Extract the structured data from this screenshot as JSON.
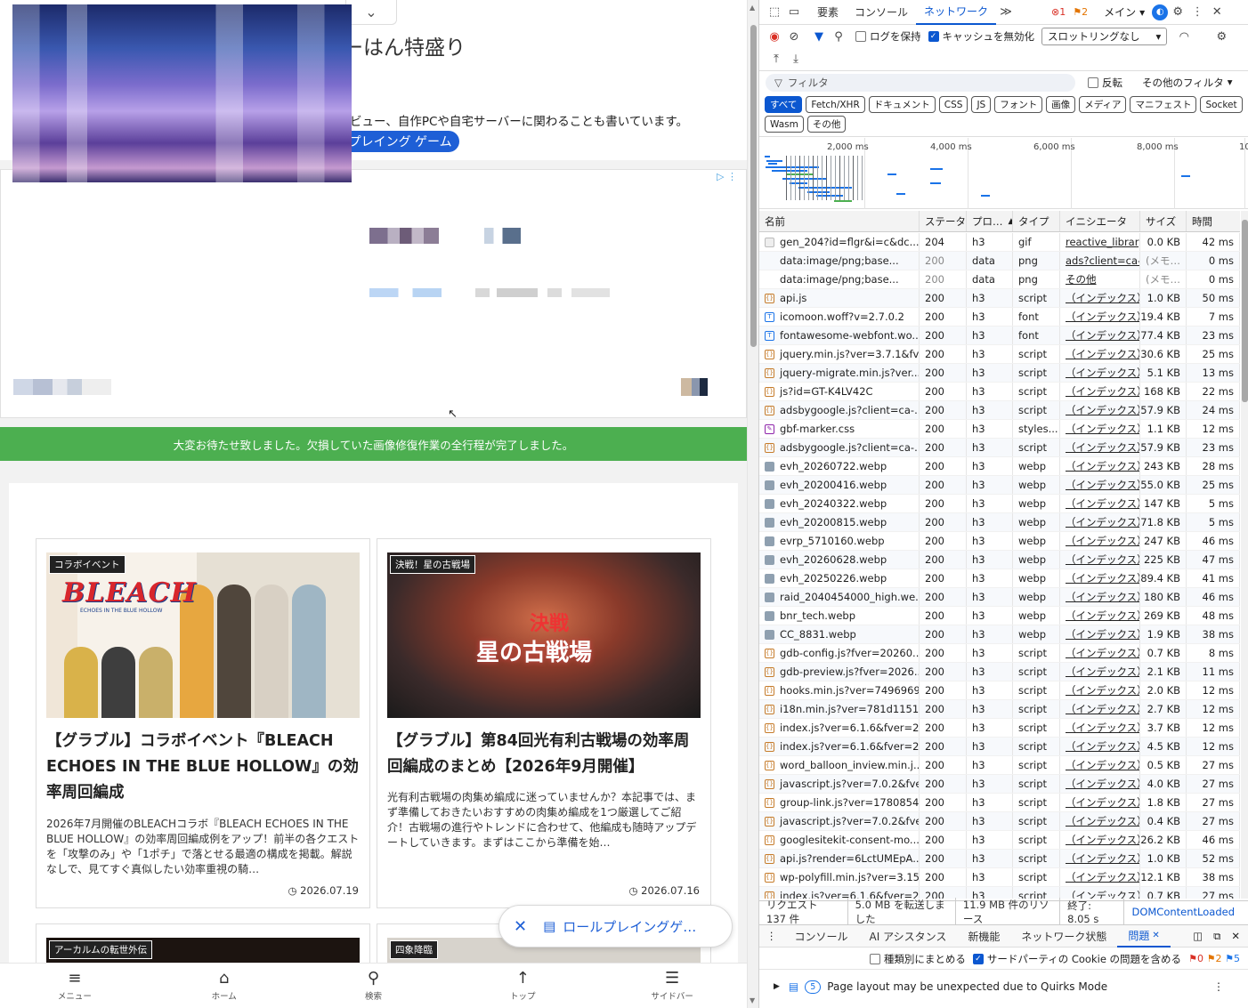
{
  "page": {
    "site_title": "半ちゃーはん特盛り",
    "site_description": "グラブルの攻略記事とその他PCパーツやデバイスのレビュー、自作PCや自宅サーバーに関わることも書いています。",
    "category_pill": "ロールプレイング ゲーム",
    "notice": "大変お待たせ致しました。欠損していた画像修復作業の全行程が完了しました。",
    "articles": [
      {
        "badge": "コラボイベント",
        "title": "【グラブル】コラボイベント『BLEACH ECHOES IN THE BLUE HOLLOW』の効率周回編成",
        "description": "2026年7月開催のBLEACHコラボ『BLEACH ECHOES IN THE BLUE HOLLOW』の効率周回編成例をアップ！前半の各クエストを「攻撃のみ」や「1ポチ」で落とせる最適の構成を掲載。解説なしで、見てすぐ真似したい効率重視の騎…",
        "date": "2026.07.19",
        "thumb_logo": "BLEACH",
        "thumb_sub": "ECHOES IN THE BLUE HOLLOW"
      },
      {
        "badge": "決戦！星の古戦場",
        "title": "【グラブル】第84回光有利古戦場の効率周回編成のまとめ【2026年9月開催】",
        "description": "光有利古戦場の肉集め編成に迷っていませんか？本記事では、まず準備しておきたいおすすめの肉集め編成を1つ厳選してご紹介！古戦場の進行やトレンドに合わせて、他編成も随時アップデートしていきます。まずはここから準備を始…",
        "date": "2026.07.16",
        "thumb_title": "星の古戦場",
        "thumb_kessen": "決戦"
      },
      {
        "badge": "アーカルムの転世外伝"
      },
      {
        "badge": "四象降臨"
      }
    ],
    "float_pill": "ロールプレイングゲ…",
    "bottom_nav": [
      {
        "icon": "≡",
        "label": "メニュー"
      },
      {
        "icon": "⌂",
        "label": "ホーム"
      },
      {
        "icon": "⚲",
        "label": "検索"
      },
      {
        "icon": "↑",
        "label": "トップ"
      },
      {
        "icon": "☰",
        "label": "サイドバー"
      }
    ]
  },
  "devtools": {
    "tabs": [
      "要素",
      "コンソール",
      "ネットワーク"
    ],
    "active_tab": "ネットワーク",
    "more_tabs": "≫",
    "error_count": "1",
    "warning_count": "2",
    "context": "メイン",
    "preserve_log": "ログを保持",
    "disable_cache": "キャッシュを無効化",
    "throttle": "スロットリングなし",
    "filter_placeholder": "フィルタ",
    "invert": "反転",
    "other_filters": "その他のフィルタ",
    "type_filters": [
      "すべて",
      "Fetch/XHR",
      "ドキュメント",
      "CSS",
      "JS",
      "フォント",
      "画像",
      "メディア",
      "マニフェスト",
      "Socket",
      "Wasm",
      "その他"
    ],
    "timeline_labels": [
      "2,000 ms",
      "4,000 ms",
      "6,000 ms",
      "8,000 ms",
      "10"
    ],
    "columns": [
      "名前",
      "ステータス",
      "プロ…",
      "タイプ",
      "イニシエータ",
      "サイズ",
      "時間"
    ],
    "requests": [
      {
        "icon": "gif",
        "name": "gen_204?id=flgr&i=c&dc...",
        "status": "204",
        "proto": "h3",
        "type": "gif",
        "initiator": "reactive_library",
        "size": "0.0 KB",
        "time": "42 ms"
      },
      {
        "icon": "none",
        "name": "data:image/png;base...",
        "status": "200",
        "proto": "data",
        "type": "png",
        "initiator": "ads?client=ca-p",
        "size": "(メモ…",
        "time": "0 ms"
      },
      {
        "icon": "none",
        "name": "data:image/png;base...",
        "status": "200",
        "proto": "data",
        "type": "png",
        "initiator": "その他",
        "size": "(メモ…",
        "time": "0 ms"
      },
      {
        "icon": "js",
        "name": "api.js",
        "status": "200",
        "proto": "h3",
        "type": "script",
        "initiator": "（インデックス）:2",
        "size": "1.0 KB",
        "time": "50 ms"
      },
      {
        "icon": "font",
        "name": "icomoon.woff?v=2.7.0.2",
        "status": "200",
        "proto": "h3",
        "type": "font",
        "initiator": "（インデックス）:5",
        "size": "19.4 KB",
        "time": "7 ms"
      },
      {
        "icon": "font",
        "name": "fontawesome-webfont.wo...",
        "status": "200",
        "proto": "h3",
        "type": "font",
        "initiator": "（インデックス）:5",
        "size": "77.4 KB",
        "time": "23 ms"
      },
      {
        "icon": "js",
        "name": "jquery.min.js?ver=3.7.1&fv...",
        "status": "200",
        "proto": "h3",
        "type": "script",
        "initiator": "（インデックス）:1",
        "size": "30.6 KB",
        "time": "25 ms"
      },
      {
        "icon": "js",
        "name": "jquery-migrate.min.js?ver...",
        "status": "200",
        "proto": "h3",
        "type": "script",
        "initiator": "（インデックス）:1",
        "size": "5.1 KB",
        "time": "13 ms"
      },
      {
        "icon": "js",
        "name": "js?id=GT-K4LV42C",
        "status": "200",
        "proto": "h3",
        "type": "script",
        "initiator": "（インデックス）:1",
        "size": "168 KB",
        "time": "22 ms"
      },
      {
        "icon": "js",
        "name": "adsbygoogle.js?client=ca-...",
        "status": "200",
        "proto": "h3",
        "type": "script",
        "initiator": "（インデックス）:1",
        "size": "57.9 KB",
        "time": "24 ms"
      },
      {
        "icon": "css",
        "name": "gbf-marker.css",
        "status": "200",
        "proto": "h3",
        "type": "styles...",
        "initiator": "（インデックス）:2",
        "size": "1.1 KB",
        "time": "12 ms"
      },
      {
        "icon": "js",
        "name": "adsbygoogle.js?client=ca-...",
        "status": "200",
        "proto": "h3",
        "type": "script",
        "initiator": "（インデックス）:4",
        "size": "57.9 KB",
        "time": "23 ms"
      },
      {
        "icon": "img",
        "name": "evh_20260722.webp",
        "status": "200",
        "proto": "h3",
        "type": "webp",
        "initiator": "（インデックス）:4",
        "size": "243 KB",
        "time": "28 ms"
      },
      {
        "icon": "img",
        "name": "evh_20200416.webp",
        "status": "200",
        "proto": "h3",
        "type": "webp",
        "initiator": "（インデックス）:4",
        "size": "55.0 KB",
        "time": "25 ms"
      },
      {
        "icon": "img",
        "name": "evh_20240322.webp",
        "status": "200",
        "proto": "h3",
        "type": "webp",
        "initiator": "（インデックス）:4",
        "size": "147 KB",
        "time": "5 ms"
      },
      {
        "icon": "img",
        "name": "evh_20200815.webp",
        "status": "200",
        "proto": "h3",
        "type": "webp",
        "initiator": "（インデックス）:4",
        "size": "71.8 KB",
        "time": "5 ms"
      },
      {
        "icon": "img",
        "name": "evrp_5710160.webp",
        "status": "200",
        "proto": "h3",
        "type": "webp",
        "initiator": "（インデックス）:5",
        "size": "247 KB",
        "time": "46 ms"
      },
      {
        "icon": "img",
        "name": "evh_20260628.webp",
        "status": "200",
        "proto": "h3",
        "type": "webp",
        "initiator": "（インデックス）:5",
        "size": "225 KB",
        "time": "47 ms"
      },
      {
        "icon": "img",
        "name": "evh_20250226.webp",
        "status": "200",
        "proto": "h3",
        "type": "webp",
        "initiator": "（インデックス）:5",
        "size": "89.4 KB",
        "time": "41 ms"
      },
      {
        "icon": "img",
        "name": "raid_2040454000_high.we...",
        "status": "200",
        "proto": "h3",
        "type": "webp",
        "initiator": "（インデックス）:6",
        "size": "180 KB",
        "time": "46 ms"
      },
      {
        "icon": "img",
        "name": "bnr_tech.webp",
        "status": "200",
        "proto": "h3",
        "type": "webp",
        "initiator": "（インデックス）:6",
        "size": "269 KB",
        "time": "48 ms"
      },
      {
        "icon": "img",
        "name": "CC_8831.webp",
        "status": "200",
        "proto": "h3",
        "type": "webp",
        "initiator": "（インデックス）:1",
        "size": "1.9 KB",
        "time": "38 ms"
      },
      {
        "icon": "js",
        "name": "gdb-config.js?fver=20260...",
        "status": "200",
        "proto": "h3",
        "type": "script",
        "initiator": "（インデックス）:1",
        "size": "0.7 KB",
        "time": "8 ms"
      },
      {
        "icon": "js",
        "name": "gdb-preview.js?fver=2026...",
        "status": "200",
        "proto": "h3",
        "type": "script",
        "initiator": "（インデックス）:1",
        "size": "2.1 KB",
        "time": "11 ms"
      },
      {
        "icon": "js",
        "name": "hooks.min.js?ver=7496969...",
        "status": "200",
        "proto": "h3",
        "type": "script",
        "initiator": "（インデックス）:1",
        "size": "2.0 KB",
        "time": "12 ms"
      },
      {
        "icon": "js",
        "name": "i18n.min.js?ver=781d1151...",
        "status": "200",
        "proto": "h3",
        "type": "script",
        "initiator": "（インデックス）:1",
        "size": "2.7 KB",
        "time": "12 ms"
      },
      {
        "icon": "js",
        "name": "index.js?ver=6.1.6&fver=2...",
        "status": "200",
        "proto": "h3",
        "type": "script",
        "initiator": "（インデックス）:1",
        "size": "3.7 KB",
        "time": "12 ms"
      },
      {
        "icon": "js",
        "name": "index.js?ver=6.1.6&fver=2...",
        "status": "200",
        "proto": "h3",
        "type": "script",
        "initiator": "（インデックス）:1",
        "size": "4.5 KB",
        "time": "12 ms"
      },
      {
        "icon": "js",
        "name": "word_balloon_inview.min.j...",
        "status": "200",
        "proto": "h3",
        "type": "script",
        "initiator": "（インデックス）:1",
        "size": "0.5 KB",
        "time": "27 ms"
      },
      {
        "icon": "js",
        "name": "javascript.js?ver=7.0.2&fve...",
        "status": "200",
        "proto": "h3",
        "type": "script",
        "initiator": "（インデックス）:1",
        "size": "4.0 KB",
        "time": "27 ms"
      },
      {
        "icon": "js",
        "name": "group-link.js?ver=1780854...",
        "status": "200",
        "proto": "h3",
        "type": "script",
        "initiator": "（インデックス）:1",
        "size": "1.8 KB",
        "time": "27 ms"
      },
      {
        "icon": "js",
        "name": "javascript.js?ver=7.0.2&fve...",
        "status": "200",
        "proto": "h3",
        "type": "script",
        "initiator": "（インデックス）:1",
        "size": "0.4 KB",
        "time": "27 ms"
      },
      {
        "icon": "js",
        "name": "googlesitekit-consent-mo...",
        "status": "200",
        "proto": "h3",
        "type": "script",
        "initiator": "（インデックス）:1",
        "size": "26.2 KB",
        "time": "46 ms"
      },
      {
        "icon": "js",
        "name": "api.js?render=6LctUMEpA...",
        "status": "200",
        "proto": "h3",
        "type": "script",
        "initiator": "（インデックス）:1",
        "size": "1.0 KB",
        "time": "52 ms"
      },
      {
        "icon": "js",
        "name": "wp-polyfill.min.js?ver=3.15...",
        "status": "200",
        "proto": "h3",
        "type": "script",
        "initiator": "（インデックス）:1",
        "size": "12.1 KB",
        "time": "38 ms"
      },
      {
        "icon": "js",
        "name": "index.js?ver=6.1.6&fver=2...",
        "status": "200",
        "proto": "h3",
        "type": "script",
        "initiator": "（インデックス）:1",
        "size": "0.7 KB",
        "time": "27 ms"
      }
    ],
    "status_bar": {
      "requests": "リクエスト 137 件",
      "transferred": "5.0 MB を転送しました",
      "resources": "11.9 MB 件のリソース",
      "finish": "終了: 8.05 s",
      "dcl": "DOMContentLoaded"
    },
    "drawer_tabs": [
      "コンソール",
      "AI アシスタンス",
      "新機能",
      "ネットワーク状態",
      "問題"
    ],
    "drawer_active": "問題",
    "issues_group": "種類別にまとめる",
    "issues_third_party": "サードパーティの Cookie の問題を含める",
    "issue_counts": {
      "error": "0",
      "warning": "2",
      "info": "5"
    },
    "issue_count": "5",
    "issue_text": "Page layout may be unexpected due to Quirks Mode"
  }
}
